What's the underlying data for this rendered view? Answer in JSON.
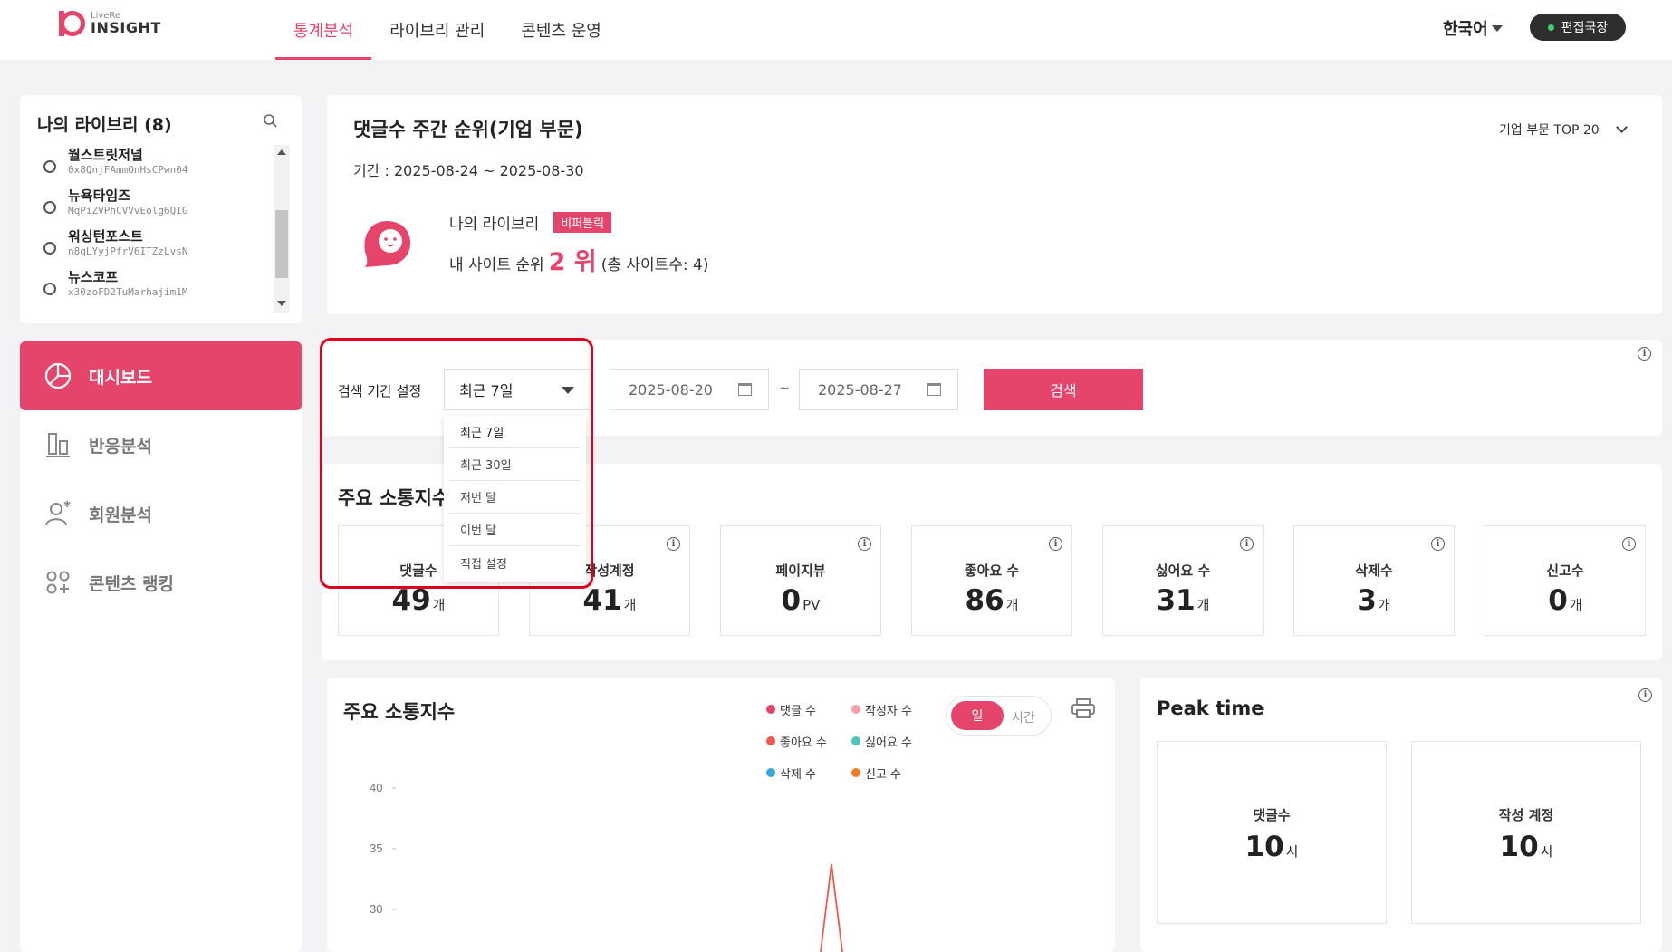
{
  "header": {
    "logo_sub": "LiveRe",
    "logo_main": "INSIGHT",
    "nav": [
      "통계분석",
      "라이브리 관리",
      "콘텐츠 운영"
    ],
    "language": "한국어",
    "user": "편집국장"
  },
  "library": {
    "title": "나의 라이브리 (8)",
    "items": [
      {
        "name": "월스트릿저널",
        "id": "0x8QnjFAmmOnHsCPwn04"
      },
      {
        "name": "뉴욕타임즈",
        "id": "MqPiZVPhCVVvEolg6QIG"
      },
      {
        "name": "워싱턴포스트",
        "id": "n8qLYyjPfrV6ITZzLvsN"
      },
      {
        "name": "뉴스코프",
        "id": "x30zoFD2TuMarhajim1M"
      }
    ]
  },
  "menu": [
    "대시보드",
    "반응분석",
    "회원분석",
    "콘텐츠 랭킹"
  ],
  "ranking": {
    "title": "댓글수 주간 순위(기업 부문)",
    "period": "기간 : 2025-08-24 ~ 2025-08-30",
    "select": "기업 부문 TOP 20",
    "library_label": "나의 라이브리",
    "badge": "비퍼블릭",
    "rank_prefix": "내 사이트 순위",
    "rank_value": "2 위",
    "rank_suffix": "(총 사이트수: 4)"
  },
  "search": {
    "label": "검색 기간 설정",
    "selected": "최근 7일",
    "start_date": "2025-08-20",
    "tilde": "~",
    "end_date": "2025-08-27",
    "button": "검색",
    "options": [
      "최근 7일",
      "최근 30일",
      "저번 달",
      "이번 달",
      "직접 설정"
    ]
  },
  "stats": {
    "title": "주요 소통지수",
    "items": [
      {
        "label": "댓글수",
        "value": "49",
        "unit": "개"
      },
      {
        "label": "작성계정",
        "value": "41",
        "unit": "개"
      },
      {
        "label": "페이지뷰",
        "value": "0",
        "unit": "PV"
      },
      {
        "label": "좋아요 수",
        "value": "86",
        "unit": "개"
      },
      {
        "label": "싫어요 수",
        "value": "31",
        "unit": "개"
      },
      {
        "label": "삭제수",
        "value": "3",
        "unit": "개"
      },
      {
        "label": "신고수",
        "value": "0",
        "unit": "개"
      }
    ]
  },
  "chart": {
    "title": "주요 소통지수",
    "legend": [
      {
        "label": "댓글 수",
        "color": "#e6456b"
      },
      {
        "label": "작성자 수",
        "color": "#f4a0a8"
      },
      {
        "label": "좋아요 수",
        "color": "#ef5a4f"
      },
      {
        "label": "싫어요 수",
        "color": "#4cc4b8"
      },
      {
        "label": "삭제 수",
        "color": "#3aa6d8"
      },
      {
        "label": "신고 수",
        "color": "#f07c2a"
      }
    ],
    "toggle_on": "일",
    "toggle_off": "시간"
  },
  "chart_data": {
    "type": "line",
    "yticks": [
      "40",
      "35",
      "30"
    ],
    "ylim": [
      30,
      40
    ]
  },
  "peak": {
    "title": "Peak time",
    "items": [
      {
        "label": "댓글수",
        "value": "10",
        "unit": "시"
      },
      {
        "label": "작성 계정",
        "value": "10",
        "unit": "시"
      }
    ]
  }
}
